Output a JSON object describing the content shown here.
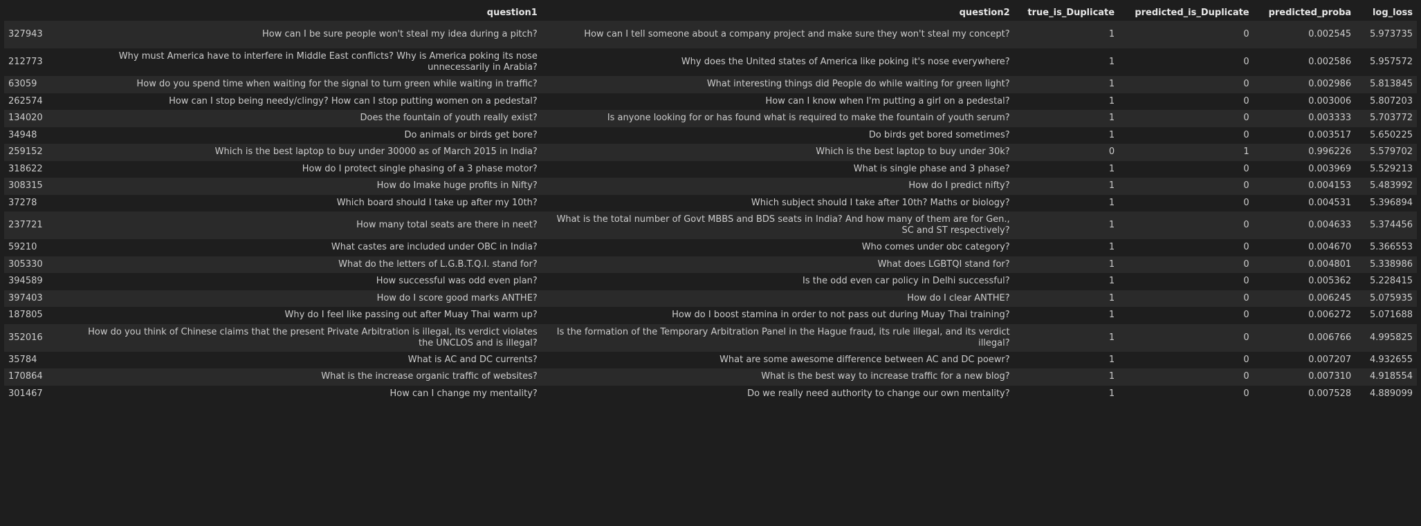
{
  "table": {
    "columns": [
      "",
      "question1",
      "question2",
      "true_is_Duplicate",
      "predicted_is_Duplicate",
      "predicted_proba",
      "log_loss"
    ],
    "rows": [
      {
        "idx": "327943",
        "q1": "How can I be sure people won't steal my idea during a pitch?",
        "q2": "How can I tell someone about a company project and make sure they won't steal my concept?",
        "true": "1",
        "pred": "0",
        "proba": "0.002545",
        "loss": "5.973735"
      },
      {
        "idx": "212773",
        "q1": "Why must America have to interfere in Middle East conflicts? Why is America poking its nose unnecessarily in Arabia?",
        "q2": "Why does the United states of America like poking it's nose everywhere?",
        "true": "1",
        "pred": "0",
        "proba": "0.002586",
        "loss": "5.957572"
      },
      {
        "idx": "63059",
        "q1": "How do you spend time when waiting for the signal to turn green while waiting in traffic?",
        "q2": "What interesting things did People do while waiting for green light?",
        "true": "1",
        "pred": "0",
        "proba": "0.002986",
        "loss": "5.813845"
      },
      {
        "idx": "262574",
        "q1": "How can I stop being needy/clingy? How can I stop putting women on a pedestal?",
        "q2": "How can I know when I'm putting a girl on a pedestal?",
        "true": "1",
        "pred": "0",
        "proba": "0.003006",
        "loss": "5.807203"
      },
      {
        "idx": "134020",
        "q1": "Does the fountain of youth really exist?",
        "q2": "Is anyone looking for or has found what is required to make the fountain of youth serum?",
        "true": "1",
        "pred": "0",
        "proba": "0.003333",
        "loss": "5.703772"
      },
      {
        "idx": "34948",
        "q1": "Do animals or birds get bore?",
        "q2": "Do birds get bored sometimes?",
        "true": "1",
        "pred": "0",
        "proba": "0.003517",
        "loss": "5.650225"
      },
      {
        "idx": "259152",
        "q1": "Which is the best laptop to buy under 30000 as of March 2015 in India?",
        "q2": "Which is the best laptop to buy under 30k?",
        "true": "0",
        "pred": "1",
        "proba": "0.996226",
        "loss": "5.579702"
      },
      {
        "idx": "318622",
        "q1": "How do I protect single phasing of a 3 phase motor?",
        "q2": "What is single phase and 3 phase?",
        "true": "1",
        "pred": "0",
        "proba": "0.003969",
        "loss": "5.529213"
      },
      {
        "idx": "308315",
        "q1": "How do Imake huge profits in Nifty?",
        "q2": "How do I predict nifty?",
        "true": "1",
        "pred": "0",
        "proba": "0.004153",
        "loss": "5.483992"
      },
      {
        "idx": "37278",
        "q1": "Which board should I take up after my 10th?",
        "q2": "Which subject should I take after 10th? Maths or biology?",
        "true": "1",
        "pred": "0",
        "proba": "0.004531",
        "loss": "5.396894"
      },
      {
        "idx": "237721",
        "q1": "How many total seats are there in neet?",
        "q2": "What is the total number of Govt MBBS and BDS seats in India? And how many of them are for Gen., SC and ST respectively?",
        "true": "1",
        "pred": "0",
        "proba": "0.004633",
        "loss": "5.374456"
      },
      {
        "idx": "59210",
        "q1": "What castes are included under OBC in India?",
        "q2": "Who comes under obc category?",
        "true": "1",
        "pred": "0",
        "proba": "0.004670",
        "loss": "5.366553"
      },
      {
        "idx": "305330",
        "q1": "What do the letters of L.G.B.T.Q.I. stand for?",
        "q2": "What does LGBTQI stand for?",
        "true": "1",
        "pred": "0",
        "proba": "0.004801",
        "loss": "5.338986"
      },
      {
        "idx": "394589",
        "q1": "How successful was odd even plan?",
        "q2": "Is the odd even car policy in Delhi successful?",
        "true": "1",
        "pred": "0",
        "proba": "0.005362",
        "loss": "5.228415"
      },
      {
        "idx": "397403",
        "q1": "How do I score good marks ANTHE?",
        "q2": "How do I clear ANTHE?",
        "true": "1",
        "pred": "0",
        "proba": "0.006245",
        "loss": "5.075935"
      },
      {
        "idx": "187805",
        "q1": "Why do I feel like passing out after Muay Thai warm up?",
        "q2": "How do I boost stamina in order to not pass out during Muay Thai training?",
        "true": "1",
        "pred": "0",
        "proba": "0.006272",
        "loss": "5.071688"
      },
      {
        "idx": "352016",
        "q1": "How do you think of Chinese claims that the present Private Arbitration is illegal, its verdict violates the UNCLOS and is illegal?",
        "q2": "Is the formation of the Temporary Arbitration Panel in the Hague fraud, its rule illegal, and its verdict illegal?",
        "true": "1",
        "pred": "0",
        "proba": "0.006766",
        "loss": "4.995825"
      },
      {
        "idx": "35784",
        "q1": "What is AC and DC currents?",
        "q2": "What are some awesome difference between AC and DC poewr?",
        "true": "1",
        "pred": "0",
        "proba": "0.007207",
        "loss": "4.932655"
      },
      {
        "idx": "170864",
        "q1": "What is the increase organic traffic of websites?",
        "q2": "What is the best way to increase traffic for a new blog?",
        "true": "1",
        "pred": "0",
        "proba": "0.007310",
        "loss": "4.918554"
      },
      {
        "idx": "301467",
        "q1": "How can I change my mentality?",
        "q2": "Do we really need authority to change our own mentality?",
        "true": "1",
        "pred": "0",
        "proba": "0.007528",
        "loss": "4.889099"
      }
    ]
  }
}
